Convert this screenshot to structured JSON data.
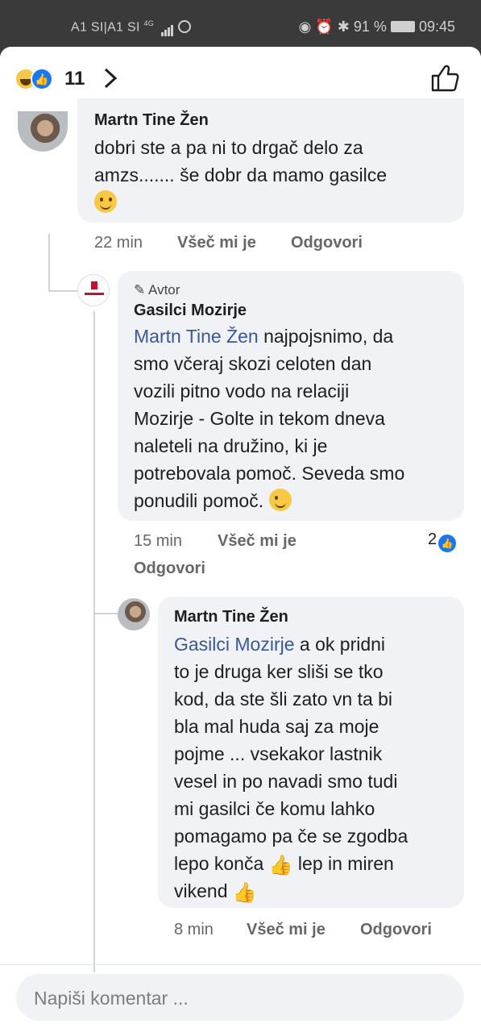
{
  "status": {
    "carrier": "A1 SI|A1 SI",
    "network": "4G",
    "battery": "91 %",
    "time": "09:45"
  },
  "reactions": {
    "count": "11",
    "types": [
      "haha-icon",
      "like-icon"
    ]
  },
  "comments": [
    {
      "author": "Martn Tine Žen",
      "lines": [
        "dobri ste a pa ni to drgač delo za",
        "amzs....... še dobr da mamo gasilce"
      ],
      "time": "22 min",
      "like_label": "Všeč mi je",
      "reply_label": "Odgovori"
    },
    {
      "author_badge": "Avtor",
      "author": "Gasilci Mozirje",
      "mention": "Martn Tine Žen",
      "first_line_rest": " najpojsnimo, da",
      "lines": [
        "smo včeraj skozi celoten dan",
        "vozili pitno vodo na relaciji",
        "Mozirje - Golte in tekom dneva",
        "naleteli na družino, ki je",
        "potrebovala pomoč. Seveda smo",
        "ponudili pomoč."
      ],
      "time": "15 min",
      "like_label": "Všeč mi je",
      "reply_label": "Odgovori",
      "like_count": "2"
    },
    {
      "author": "Martn Tine Žen",
      "mention": "Gasilci Mozirje",
      "first_line_rest": " a ok  pridni",
      "lines": [
        "to je druga ker sliši se tko",
        "kod, da ste šli zato vn ta bi",
        "bla mal  huda saj za moje",
        "pojme ...  vsekakor lastnik",
        "vesel in po navadi smo tudi",
        "mi  gasilci če komu lahko",
        "pomagamo pa če se zgodba",
        "lepo konča",
        " lep in miren",
        "vikend"
      ],
      "time": "8 min",
      "like_label": "Všeč mi je",
      "reply_label": "Odgovori"
    }
  ],
  "composer": {
    "placeholder": "Napiši komentar ..."
  }
}
